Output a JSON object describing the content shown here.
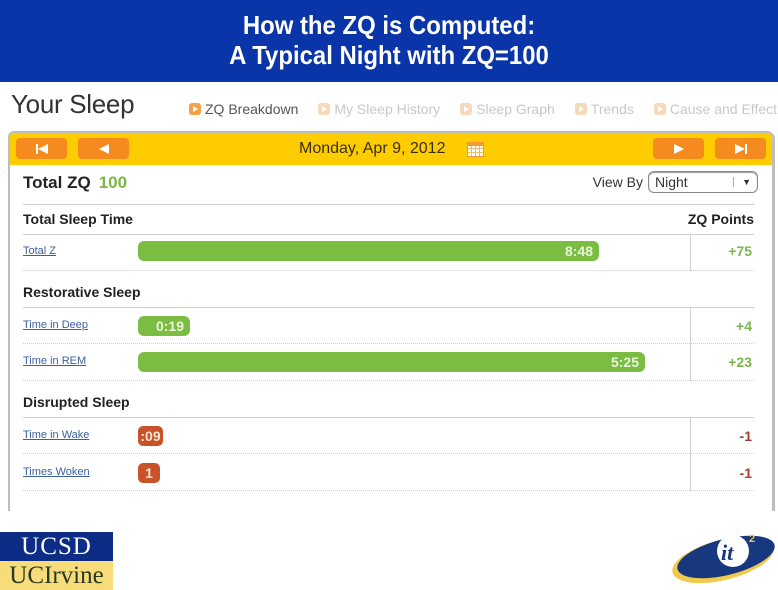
{
  "slide": {
    "title_line1": "How the ZQ is Computed:",
    "title_line2": "A Typical Night with ZQ=100"
  },
  "app": {
    "title": "Your Sleep",
    "nav": [
      {
        "label": "ZQ Breakdown",
        "active": true,
        "icon": "play-icon"
      },
      {
        "label": "My Sleep History",
        "active": false,
        "icon": "play-icon"
      },
      {
        "label": "Sleep Graph",
        "active": false,
        "icon": "play-icon"
      },
      {
        "label": "Trends",
        "active": false,
        "icon": "play-icon"
      },
      {
        "label": "Cause and Effect",
        "active": false,
        "icon": "play-icon"
      }
    ]
  },
  "datebar": {
    "date": "Monday, Apr 9, 2012",
    "buttons": [
      "first-icon",
      "prev-icon",
      "next-icon",
      "last-icon"
    ],
    "calendar_icon": "calendar-icon"
  },
  "summary": {
    "label": "Total ZQ",
    "value": "100",
    "view_by_label": "View By",
    "view_by_value": "Night"
  },
  "table": {
    "points_header": "ZQ Points",
    "sections": [
      {
        "title": "Total Sleep Time",
        "rows": [
          {
            "label": "Total Z",
            "value": "8:48",
            "fraction": 0.845,
            "points": "+75",
            "kind": "positive"
          }
        ]
      },
      {
        "title": "Restorative Sleep",
        "rows": [
          {
            "label": "Time in Deep",
            "value": "0:19",
            "fraction": 0.095,
            "points": "+4",
            "kind": "positive"
          },
          {
            "label": "Time in REM",
            "value": "5:25",
            "fraction": 0.93,
            "points": "+23",
            "kind": "positive"
          }
        ]
      },
      {
        "title": "Disrupted Sleep",
        "rows": [
          {
            "label": "Time in Wake",
            "value": ":09",
            "fraction": 0.045,
            "points": "-1",
            "kind": "negative"
          },
          {
            "label": "Times Woken",
            "value": "1",
            "fraction": 0.03,
            "points": "-1",
            "kind": "negative"
          }
        ]
      }
    ]
  },
  "colors": {
    "title_bg": "#0a35a8",
    "date_bar": "#ffcc00",
    "nav_button": "#f58a1f",
    "positive_bar": "#7bbd43",
    "negative_bar": "#c8532a",
    "positive_text": "#7ab648",
    "negative_text": "#a63a2c"
  },
  "logos": {
    "left_top": "UCSD",
    "left_bottom": "UCIrvine",
    "right": "it2"
  }
}
